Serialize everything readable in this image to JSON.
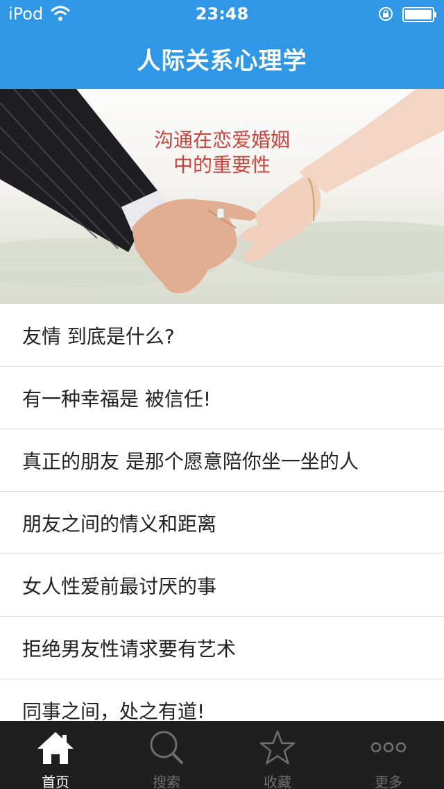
{
  "status_bar": {
    "carrier": "iPod",
    "time": "23:48"
  },
  "nav": {
    "title": "人际关系心理学"
  },
  "banner": {
    "caption_line1": "沟通在恋爱婚姻",
    "caption_line2": "中的重要性"
  },
  "list": {
    "items": [
      "友情 到底是什么?",
      "有一种幸福是 被信任!",
      "真正的朋友 是那个愿意陪你坐一坐的人",
      "朋友之间的情义和距离",
      "女人性爱前最讨厌的事",
      "拒绝男友性请求要有艺术",
      "同事之间，处之有道!"
    ]
  },
  "tabbar": {
    "tabs": [
      {
        "label": "首页",
        "icon": "home-icon",
        "active": true
      },
      {
        "label": "搜索",
        "icon": "search-icon",
        "active": false
      },
      {
        "label": "收藏",
        "icon": "star-icon",
        "active": false
      },
      {
        "label": "更多",
        "icon": "more-icon",
        "active": false
      }
    ]
  },
  "colors": {
    "nav_bg": "#2f97e5",
    "tab_bg": "#1f1f1f",
    "caption": "#c9453f"
  }
}
